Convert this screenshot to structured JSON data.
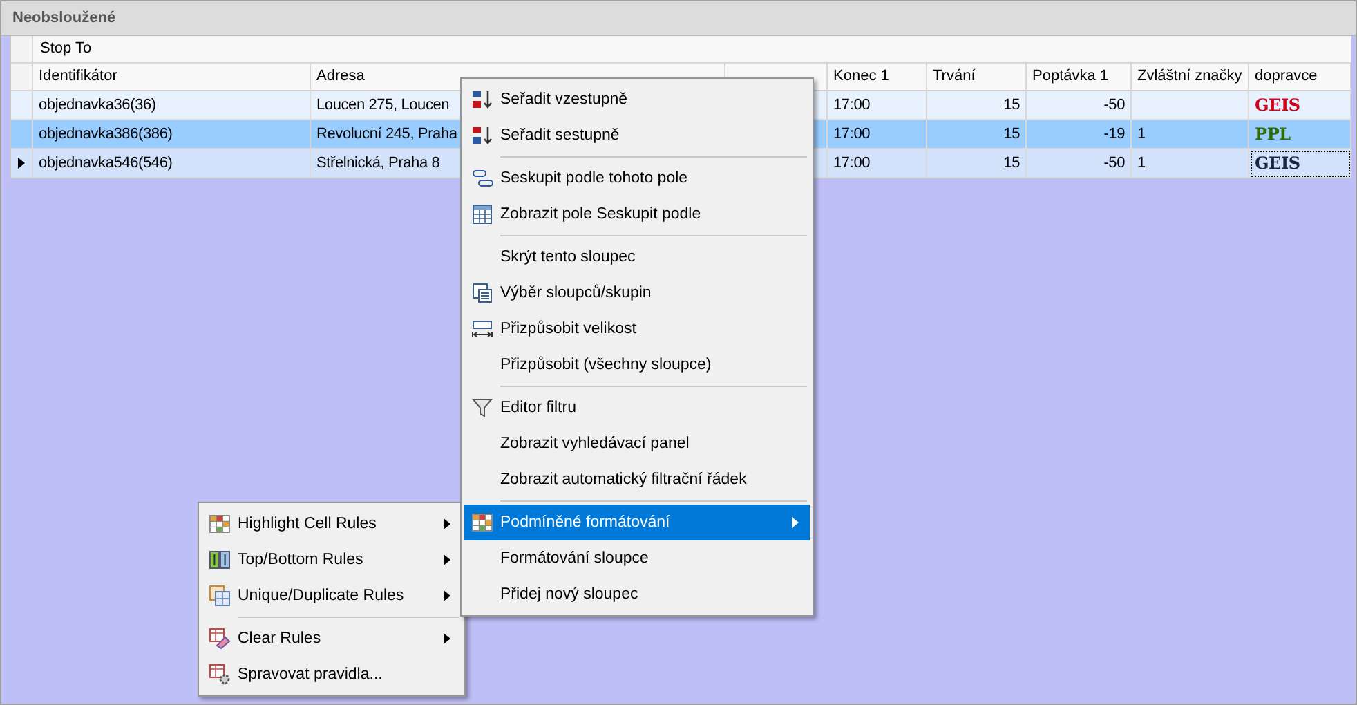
{
  "panel": {
    "title": "Neobsloužené"
  },
  "group_band": "Stop To",
  "table": {
    "columns": [
      "Identifikátor",
      "Adresa",
      "Konec 1",
      "Trvání",
      "Poptávka 1",
      "Zvláštní značky",
      "dopravce"
    ],
    "rows": [
      {
        "selected": false,
        "focused": false,
        "id": "objednavka36(36)",
        "address": "Loucen 275, Loucen",
        "end": "17:00",
        "duration": "15",
        "demand": "-50",
        "marks": "",
        "carrier": "GEIS",
        "color": "#d0021b"
      },
      {
        "selected": true,
        "focused": false,
        "id": "objednavka386(386)",
        "address": "Revolucní 245, Praha",
        "end": "17:00",
        "duration": "15",
        "demand": "-19",
        "marks": "1",
        "carrier": "PPL",
        "color": "#2e6b00"
      },
      {
        "selected": false,
        "focused": true,
        "id": "objednavka546(546)",
        "address": "Střelnická, Praha 8",
        "end": "17:00",
        "duration": "15",
        "demand": "-50",
        "marks": "1",
        "carrier": "GEIS",
        "color": "#1b2540"
      }
    ]
  },
  "context_menu": {
    "groups": [
      [
        {
          "kind": "sort-asc",
          "label": "Seřadit vzestupně",
          "submenu": false,
          "selected": false
        },
        {
          "kind": "sort-desc",
          "label": "Seřadit sestupně",
          "submenu": false,
          "selected": false
        }
      ],
      [
        {
          "kind": "group",
          "label": "Seskupit podle tohoto pole",
          "submenu": false,
          "selected": false
        },
        {
          "kind": "group-panel",
          "label": "Zobrazit pole Seskupit podle",
          "submenu": false,
          "selected": false
        }
      ],
      [
        {
          "kind": "plain",
          "label": "Skrýt tento sloupec",
          "submenu": false,
          "selected": false
        },
        {
          "kind": "columns",
          "label": "Výběr sloupců/skupin",
          "submenu": false,
          "selected": false
        },
        {
          "kind": "fit",
          "label": "Přizpůsobit velikost",
          "submenu": false,
          "selected": false
        },
        {
          "kind": "plain",
          "label": "Přizpůsobit (všechny sloupce)",
          "submenu": false,
          "selected": false
        }
      ],
      [
        {
          "kind": "filter",
          "label": "Editor filtru",
          "submenu": false,
          "selected": false
        },
        {
          "kind": "plain",
          "label": "Zobrazit vyhledávací panel",
          "submenu": false,
          "selected": false
        },
        {
          "kind": "plain",
          "label": "Zobrazit automatický filtrační řádek",
          "submenu": false,
          "selected": false
        }
      ],
      [
        {
          "kind": "format",
          "label": "Podmíněné formátování",
          "submenu": true,
          "selected": true
        },
        {
          "kind": "plain",
          "label": "Formátování sloupce",
          "submenu": false,
          "selected": false
        },
        {
          "kind": "plain",
          "label": "Přidej nový sloupec",
          "submenu": false,
          "selected": false
        }
      ]
    ]
  },
  "submenu": {
    "groups": [
      [
        {
          "kind": "highlight",
          "label": "Highlight Cell Rules",
          "submenu": true,
          "selected": false
        },
        {
          "kind": "topbottom",
          "label": "Top/Bottom Rules",
          "submenu": true,
          "selected": false
        },
        {
          "kind": "unique",
          "label": "Unique/Duplicate Rules",
          "submenu": true,
          "selected": false
        }
      ],
      [
        {
          "kind": "clear",
          "label": "Clear Rules",
          "submenu": true,
          "selected": false
        },
        {
          "kind": "manage",
          "label": "Spravovat pravidla...",
          "submenu": false,
          "selected": false
        }
      ]
    ]
  }
}
